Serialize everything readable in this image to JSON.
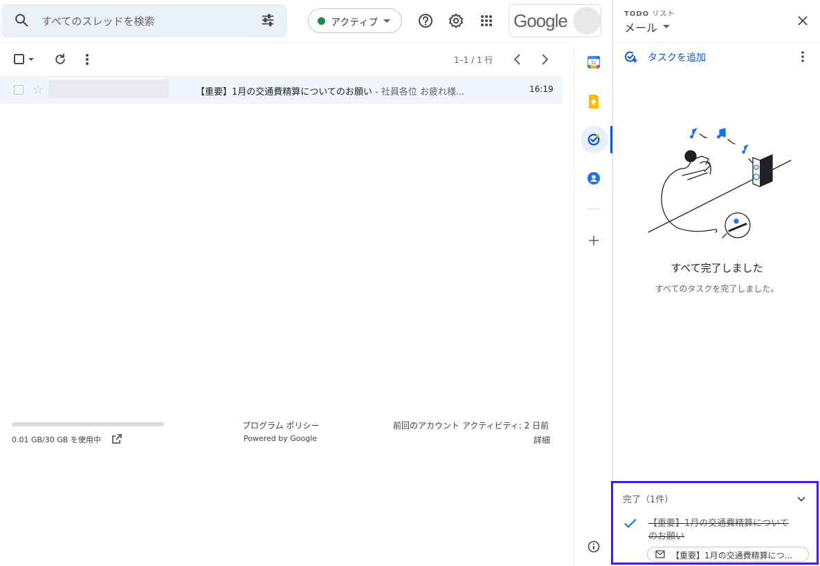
{
  "search": {
    "placeholder": "すべてのスレッドを検索"
  },
  "status": {
    "label": "アクティブ"
  },
  "brand": {
    "logo_text": "Google"
  },
  "toolbar": {
    "page_info": "1–1 / 1 行"
  },
  "thread": {
    "subject": "【重要】1月の交通費精算についてのお願い",
    "snippet": " - 社員各位 お疲れ様...",
    "time": "16:19"
  },
  "footer": {
    "storage_used_fraction": 0.0003,
    "storage": "0.01 GB/30 GB を使用中",
    "policy": "プログラム ポリシー",
    "powered": "Powered by Google",
    "activity": "前回のアカウント アクティビティ: 2 日前",
    "details": "詳細"
  },
  "tasks_panel": {
    "eyebrow_bold": "TODO",
    "eyebrow_rest": " リスト",
    "list_name": "メール",
    "add_task": "タスクを追加",
    "empty_title": "すべて完了しました",
    "empty_subtitle": "すべてのタスクを完了しました。",
    "completed_header": "完了（1件）",
    "completed_task_title": "【重要】1月の交通費精算についてのお願い",
    "completed_task_chip": "【重要】1月の交通費精算につ..."
  },
  "strip": {
    "calendar_day": "31"
  },
  "icons": [
    "search-icon",
    "tune-icon",
    "help-icon",
    "settings-icon",
    "apps-icon",
    "refresh-icon",
    "more-vert-icon",
    "chevron-left-icon",
    "chevron-right-icon",
    "calendar-icon",
    "keep-icon",
    "tasks-icon",
    "contacts-icon",
    "plus-icon",
    "info-icon",
    "close-icon",
    "add-task-icon",
    "check-icon",
    "mail-icon",
    "external-link-icon"
  ],
  "colors": {
    "accent": "#0b57d0",
    "active_dot": "#1e8e3e",
    "highlight_border": "#3c1cf0",
    "search_bg": "#eaf1fb"
  }
}
